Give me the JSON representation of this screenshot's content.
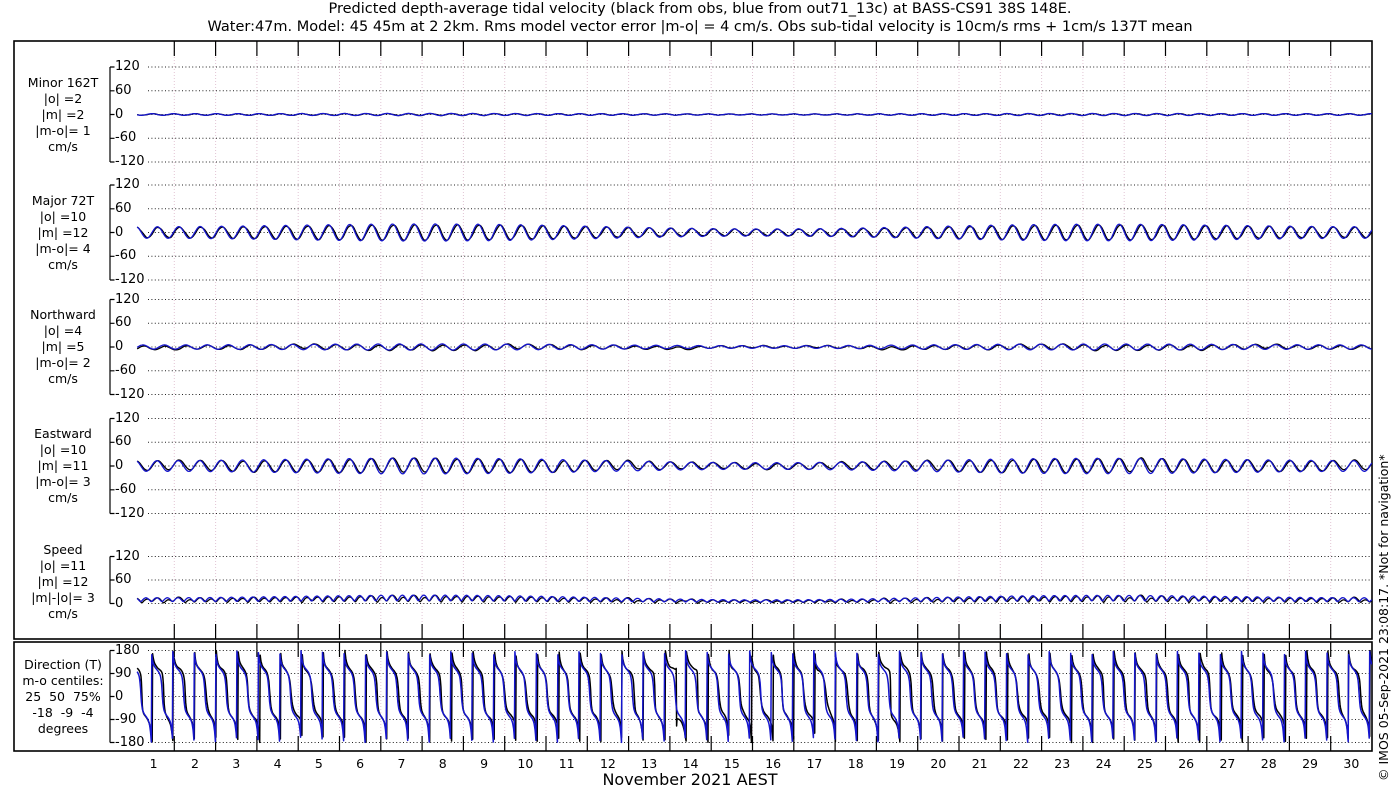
{
  "page": {
    "title_line1": "Predicted depth-average tidal velocity (black from obs, blue from out71_13c) at BASS-CS91 38S 148E.",
    "title_line2": "Water:47m. Model: 45 45m at 2 2km. Rms model vector error |m-o| = 4 cm/s. Obs sub-tidal velocity is 10cm/s rms + 1cm/s 137T mean",
    "x_axis_label": "November 2021 AEST",
    "watermark": "© IMOS 05-Sep-2021 23:08:17. *Not for navigation*"
  },
  "colors": {
    "obs": "#000000",
    "model": "#1515cd",
    "day_grid": "#e2c4d4",
    "h_grid": "#222222",
    "frame": "#000000"
  },
  "chart_data": {
    "type": "line",
    "x_unit": "day of November 2021 (AEST)",
    "x_range_days": [
      0,
      30
    ],
    "x_tick_labels": [
      "1",
      "2",
      "3",
      "4",
      "5",
      "6",
      "7",
      "8",
      "9",
      "10",
      "11",
      "12",
      "13",
      "14",
      "15",
      "16",
      "17",
      "18",
      "19",
      "20",
      "21",
      "22",
      "23",
      "24",
      "25",
      "26",
      "27",
      "28",
      "29",
      "30"
    ],
    "legend": {
      "black": "obs",
      "blue": "model out71_13c"
    },
    "panels": [
      {
        "name": "Minor 162T",
        "label_lines": [
          "Minor 162T",
          "|o| =2",
          "|m| =2",
          "|m-o|= 1",
          "cm/s"
        ],
        "units": "cm/s",
        "yticks": [
          120,
          60,
          0,
          -60,
          -120
        ],
        "ylim": [
          -120,
          120
        ],
        "stats": {
          "obs_rms_cms": 2,
          "model_rms_cms": 2,
          "model_minus_obs_rms_cms": 1
        }
      },
      {
        "name": "Major 72T",
        "label_lines": [
          "Major 72T",
          "|o| =10",
          "|m| =12",
          "|m-o|= 4",
          "cm/s"
        ],
        "units": "cm/s",
        "yticks": [
          120,
          60,
          0,
          -60,
          -120
        ],
        "ylim": [
          -120,
          120
        ],
        "stats": {
          "obs_rms_cms": 10,
          "model_rms_cms": 12,
          "model_minus_obs_rms_cms": 4
        }
      },
      {
        "name": "Northward",
        "label_lines": [
          "Northward",
          "|o| =4",
          "|m| =5",
          "|m-o|= 2",
          "cm/s"
        ],
        "units": "cm/s",
        "yticks": [
          120,
          60,
          0,
          -60,
          -120
        ],
        "ylim": [
          -120,
          120
        ],
        "stats": {
          "obs_rms_cms": 4,
          "model_rms_cms": 5,
          "model_minus_obs_rms_cms": 2
        }
      },
      {
        "name": "Eastward",
        "label_lines": [
          "Eastward",
          "|o| =10",
          "|m| =11",
          "|m-o|= 3",
          "cm/s"
        ],
        "units": "cm/s",
        "yticks": [
          120,
          60,
          0,
          -60,
          -120
        ],
        "ylim": [
          -120,
          120
        ],
        "stats": {
          "obs_rms_cms": 10,
          "model_rms_cms": 11,
          "model_minus_obs_rms_cms": 3
        }
      },
      {
        "name": "Speed",
        "label_lines": [
          "Speed",
          "|o| =11",
          "|m| =12",
          "|m|-|o|= 3",
          "cm/s"
        ],
        "units": "cm/s",
        "yticks": [
          120,
          60,
          0
        ],
        "ylim": [
          0,
          120
        ],
        "stats": {
          "obs_rms_cms": 11,
          "model_rms_cms": 12,
          "abs_model_minus_abs_obs_cms": 3
        }
      },
      {
        "name": "Direction (T)",
        "label_lines": [
          "Direction (T)",
          "m-o centiles:",
          "25  50  75%",
          "-18  -9  -4",
          "degrees"
        ],
        "units": "degrees",
        "yticks": [
          180,
          90,
          0,
          -90,
          -180
        ],
        "ylim": [
          -180,
          180
        ],
        "stats": {
          "m_minus_o_centile_pcts": [
            25,
            50,
            75
          ],
          "m_minus_o_centile_degs": [
            -18,
            -9,
            -4
          ]
        }
      }
    ],
    "generator": {
      "comment": "Tidal time-series synthesis parameters (semidiurnal tide with spring-neap beats) used to redraw the curves; obs=black, model=blue.",
      "tidal_freq_cpd": 1.9324,
      "beats": [
        {
          "period_days": 14.77,
          "center_day": 22.6
        },
        {
          "period_days": 27.6,
          "center_day": 29.5
        }
      ],
      "components": {
        "major": {
          "base": 8.0,
          "b1": 8.0,
          "b2": 5.0,
          "phase": 0.4
        },
        "minor": {
          "base": 1.3,
          "b1": 0.8,
          "b2": 0.5,
          "phase": 2.0
        },
        "east": {
          "base": 7.4,
          "b1": 7.4,
          "b2": 4.6,
          "phase": 0.55
        },
        "north": {
          "base": 2.9,
          "b1": 2.9,
          "b2": 1.8,
          "phase": -1.65
        }
      },
      "model": {
        "amp_factor": 1.12,
        "phase_shift_rad": 0.28,
        "speed_offset_cms": 0.8
      },
      "subtidal": {
        "rms_cms": 3.0,
        "mean_east_cms": 0.68,
        "mean_north_cms": -0.73
      },
      "samples_per_day": 96
    }
  }
}
